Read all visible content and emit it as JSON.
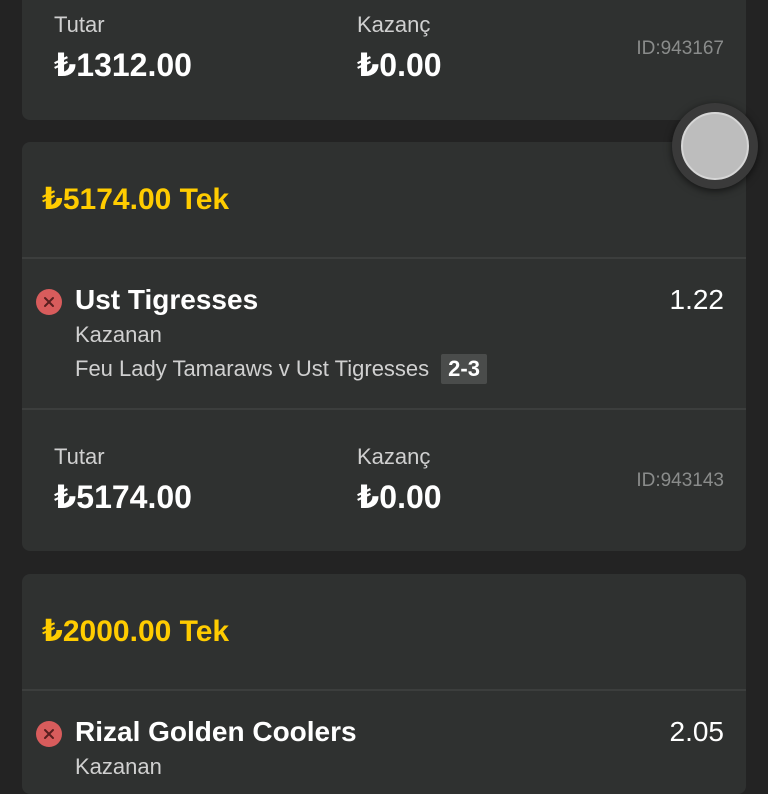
{
  "bets": [
    {
      "amount_label": "Tutar",
      "amount": "₺1312.00",
      "win_label": "Kazanç",
      "win": "₺0.00",
      "id": "ID:943167"
    },
    {
      "stake_title": "₺5174.00 Tek",
      "selection": {
        "name": "Ust Tigresses",
        "odds": "1.22",
        "market": "Kazanan",
        "event": "Feu Lady Tamaraws v Ust Tigresses",
        "score": "2-3",
        "status_icon": "lost-x-icon"
      },
      "amount_label": "Tutar",
      "amount": "₺5174.00",
      "win_label": "Kazanç",
      "win": "₺0.00",
      "id": "ID:943143"
    },
    {
      "stake_title": "₺2000.00 Tek",
      "selection": {
        "name": "Rizal Golden Coolers",
        "odds": "2.05",
        "market": "Kazanan",
        "status_icon": "lost-x-icon"
      }
    }
  ],
  "colors": {
    "background": "#232323",
    "card": "#2f3130",
    "stake_title": "#ffcc00",
    "lost_icon": "#d85c5c",
    "divider": "#3c3e3d"
  },
  "fab_icon": "floating-circle-button"
}
